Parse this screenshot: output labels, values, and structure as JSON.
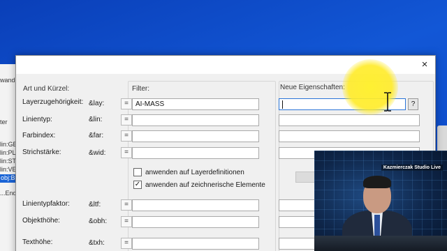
{
  "background_app": {
    "fragments": [
      "wand",
      "ter",
      "lin:GB",
      "lin:PL",
      "lin:ST",
      "lin:VE",
      "obj:B",
      "...End"
    ]
  },
  "dialog": {
    "close_glyph": "×",
    "headers": {
      "left": "Art und Kürzel:",
      "filter": "Filter:",
      "new": "Neue Eigenschaften:"
    },
    "rows": [
      {
        "label": "Layerzugehörigkeit:",
        "code": "&lay:",
        "eq": "=",
        "filter_value": "AI-MASS",
        "new_value": ""
      },
      {
        "label": "Linientyp:",
        "code": "&lin:",
        "eq": "=",
        "filter_value": "",
        "new_value": ""
      },
      {
        "label": "Farbindex:",
        "code": "&far:",
        "eq": "=",
        "filter_value": "",
        "new_value": ""
      },
      {
        "label": "Strichstärke:",
        "code": "&wid:",
        "eq": "=",
        "filter_value": "",
        "new_value": ""
      },
      {
        "label": "Linientypfaktor:",
        "code": "&ltf:",
        "eq": "=",
        "filter_value": "",
        "new_value": ""
      },
      {
        "label": "Objekthöhe:",
        "code": "&obh:",
        "eq": "=",
        "filter_value": "",
        "new_value": ""
      },
      {
        "label": "Texthöhe:",
        "code": "&txh:",
        "eq": "=",
        "filter_value": "",
        "new_value": ""
      }
    ],
    "help_button": "?",
    "checkboxes": [
      {
        "label": "anwenden auf Layerdefinitionen",
        "checked": false
      },
      {
        "label": "anwenden auf zeichnerische Elemente",
        "checked": true
      }
    ]
  },
  "webcam": {
    "caption": "Kazmierczak Studio Live"
  },
  "colors": {
    "desktop_blue": "#1257d6",
    "highlight_yellow": "#ffeb28",
    "selection_blue": "#1a64d6"
  }
}
